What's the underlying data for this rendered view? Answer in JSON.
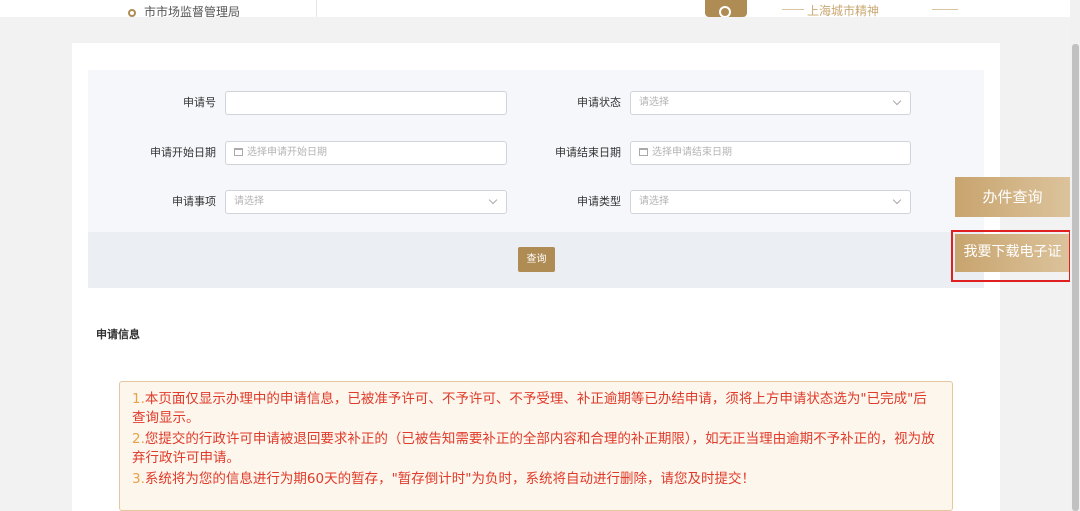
{
  "header": {
    "department": "市市场监督管理局",
    "slogan": "上海城市精神"
  },
  "search_form": {
    "application_no": {
      "label": "申请号",
      "value": ""
    },
    "application_status": {
      "label": "申请状态",
      "placeholder": "请选择"
    },
    "start_date": {
      "label": "申请开始日期",
      "placeholder": "选择申请开始日期"
    },
    "end_date": {
      "label": "申请结束日期",
      "placeholder": "选择申请结束日期"
    },
    "matter": {
      "label": "申请事项",
      "placeholder": "请选择"
    },
    "type": {
      "label": "申请类型",
      "placeholder": "请选择"
    },
    "query_button": "查询"
  },
  "section": {
    "title": "申请信息"
  },
  "notice": [
    {
      "num": "1.",
      "text": "本页面仅显示办理中的申请信息，已被准予许可、不予许可、不予受理、补正逾期等已办结申请，须将上方申请状态选为\"已完成\"后查询显示。"
    },
    {
      "num": "2.",
      "text": "您提交的行政许可申请被退回要求补正的（已被告知需要补正的全部内容和合理的补正期限），如无正当理由逾期不予补正的，视为放弃行政许可申请。"
    },
    {
      "num": "3.",
      "text": "系统将为您的信息进行为期60天的暂存，\"暂存倒计时\"为负时，系统将自动进行删除，请您及时提交！"
    }
  ],
  "side": {
    "query": "办件查询",
    "download": "我要下载电子证"
  },
  "colors": {
    "accent": "#b08c55",
    "notice_text": "#e03a2a",
    "highlight": "#e02020"
  }
}
